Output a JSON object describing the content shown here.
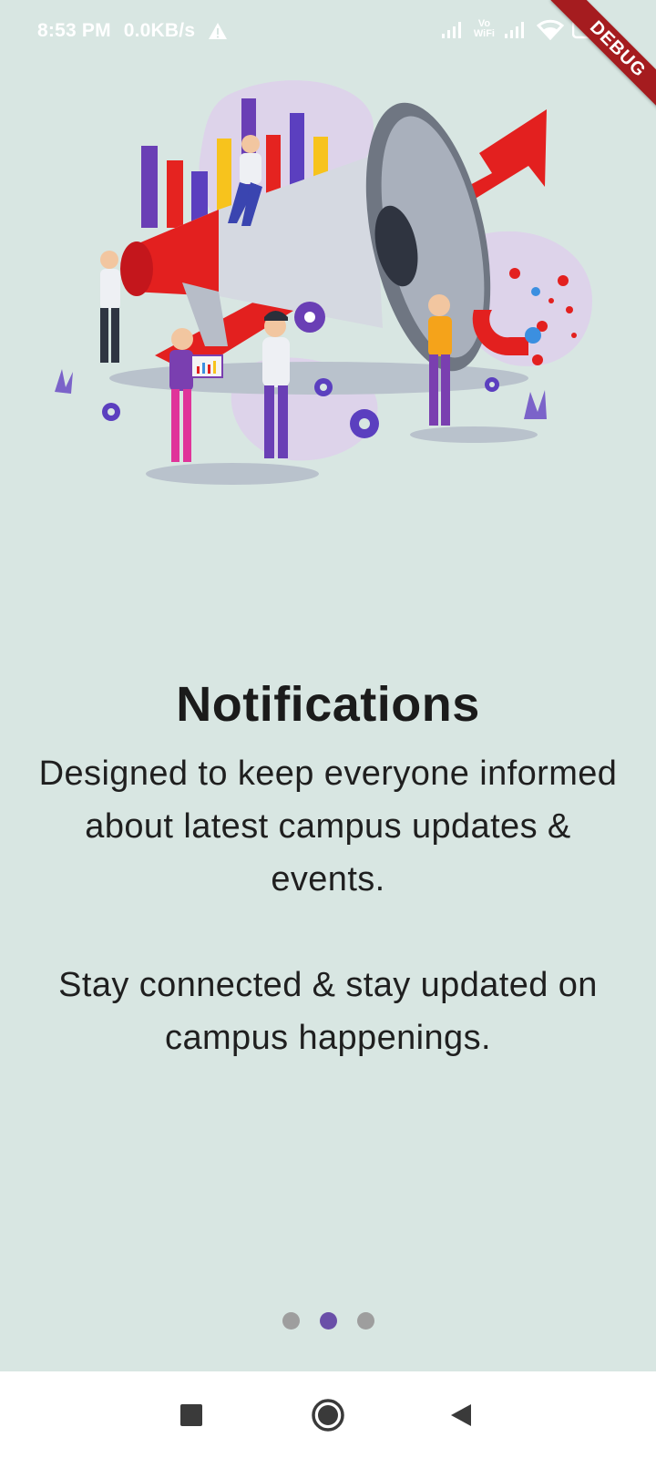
{
  "status_bar": {
    "time": "8:53 PM",
    "speed": "0.0KB/s",
    "volte_top": "Vo",
    "volte_bottom": "WiFi",
    "icons": [
      "warning-icon",
      "signal-icon",
      "wifi-icon",
      "battery-icon"
    ]
  },
  "debug_banner": "DEBUG",
  "onboarding": {
    "title": "Notifications",
    "description_1": "Designed to keep everyone informed about latest campus updates & events.",
    "description_2": "Stay connected & stay updated on campus happenings.",
    "page_count": 3,
    "current_page": 2
  },
  "nav": {
    "icons": [
      "recent-apps-icon",
      "home-icon",
      "back-icon"
    ]
  },
  "colors": {
    "background": "#d8e6e2",
    "accent": "#6a4fa8",
    "dot_inactive": "#9e9e9e",
    "ribbon": "#a51c1f"
  }
}
